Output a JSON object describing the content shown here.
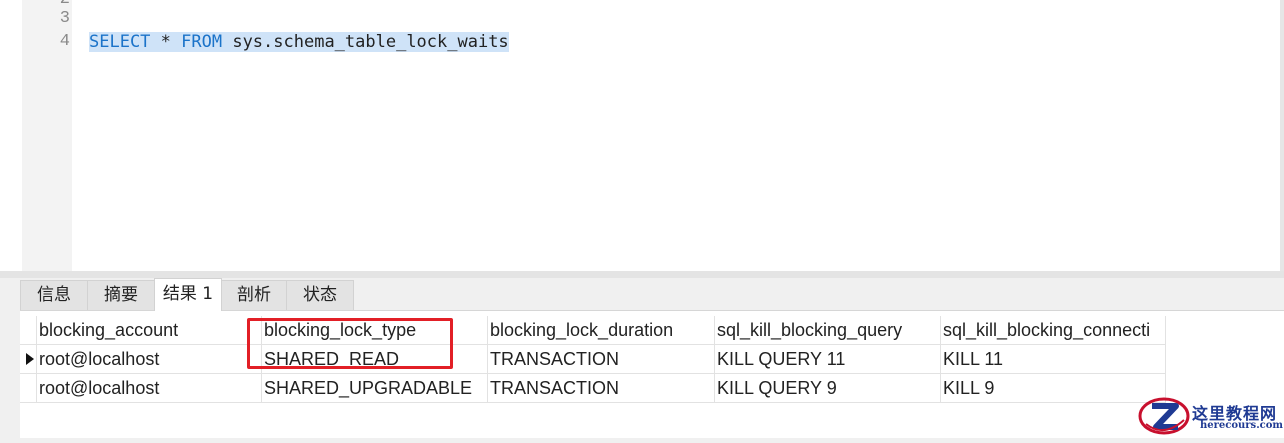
{
  "editor": {
    "line_numbers": [
      "2",
      "3",
      "4"
    ],
    "sql": {
      "kw_select": "SELECT",
      "star": " * ",
      "kw_from": "FROM",
      "rest": " sys.schema_table_lock_waits"
    }
  },
  "tabs": [
    {
      "label": "信息",
      "active": false
    },
    {
      "label": "摘要",
      "active": false
    },
    {
      "label": "结果 1",
      "active": true
    },
    {
      "label": "剖析",
      "active": false
    },
    {
      "label": "状态",
      "active": false
    }
  ],
  "grid": {
    "columns": [
      "blocking_account",
      "blocking_lock_type",
      "blocking_lock_duration",
      "sql_kill_blocking_query",
      "sql_kill_blocking_connecti"
    ],
    "rows": [
      [
        "root@localhost",
        "SHARED_READ",
        "TRANSACTION",
        "KILL QUERY 11",
        "KILL 11"
      ],
      [
        "root@localhost",
        "SHARED_UPGRADABLE",
        "TRANSACTION",
        "KILL QUERY 9",
        "KILL 9"
      ]
    ],
    "current_row": 0
  },
  "watermark": {
    "title": "这里教程网",
    "subtitle": "herecours.com",
    "logo_letter": "Z"
  },
  "colors": {
    "keyword": "#1b73c9",
    "selection": "#cfe3f8",
    "highlight_box": "#e21f26"
  }
}
